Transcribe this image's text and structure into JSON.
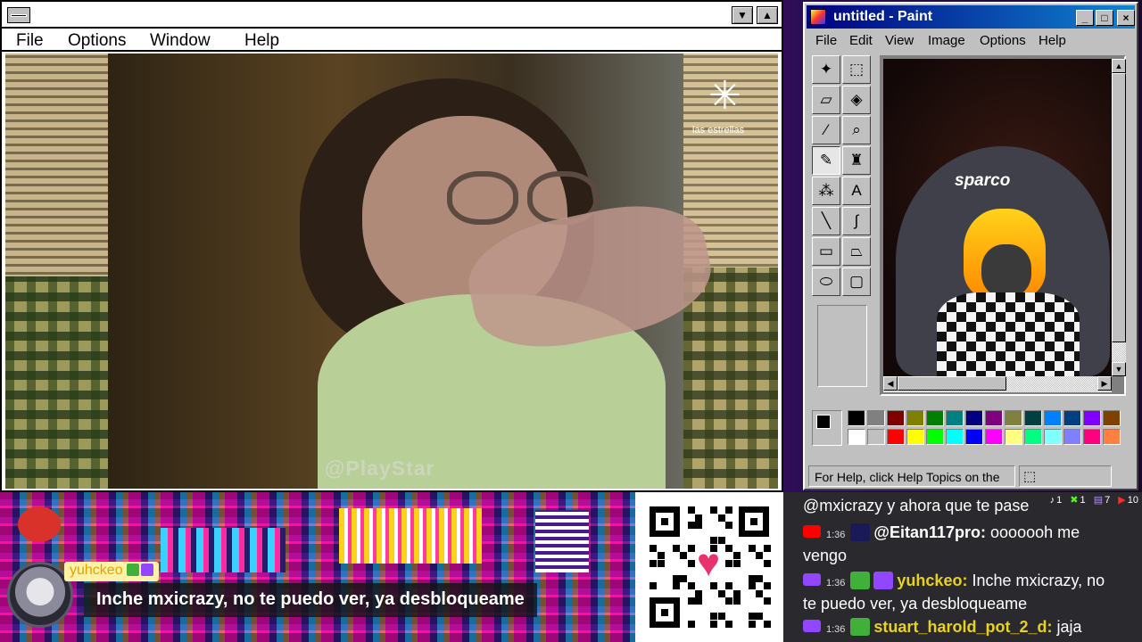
{
  "media_window": {
    "menu": [
      "File",
      "Options",
      "Window",
      "Help"
    ],
    "title_buttons": {
      "minimize": "▼",
      "maximize": "▲"
    },
    "video": {
      "watermark": "@PlayStar",
      "logo_text": "las estrellas"
    }
  },
  "paint": {
    "title": "untitled - Paint",
    "menu": [
      "File",
      "Edit",
      "View",
      "Image",
      "Options",
      "Help"
    ],
    "tools": [
      {
        "name": "free-select-icon",
        "glyph": "✦"
      },
      {
        "name": "rect-select-icon",
        "glyph": "⬚"
      },
      {
        "name": "eraser-icon",
        "glyph": "▱"
      },
      {
        "name": "fill-bucket-icon",
        "glyph": "◈"
      },
      {
        "name": "color-picker-icon",
        "glyph": "⁄"
      },
      {
        "name": "magnifier-icon",
        "glyph": "⌕"
      },
      {
        "name": "pencil-icon",
        "glyph": "✎"
      },
      {
        "name": "brush-icon",
        "glyph": "♜"
      },
      {
        "name": "airbrush-icon",
        "glyph": "⁂"
      },
      {
        "name": "text-icon",
        "glyph": "A"
      },
      {
        "name": "line-icon",
        "glyph": "╲"
      },
      {
        "name": "curve-icon",
        "glyph": "∫"
      },
      {
        "name": "rectangle-icon",
        "glyph": "▭"
      },
      {
        "name": "polygon-icon",
        "glyph": "⏢"
      },
      {
        "name": "ellipse-icon",
        "glyph": "⬭"
      },
      {
        "name": "rounded-rect-icon",
        "glyph": "▢"
      }
    ],
    "canvas_chair_logo": "sparco",
    "palette_top": [
      "#000000",
      "#808080",
      "#800000",
      "#808000",
      "#008000",
      "#008080",
      "#000080",
      "#800080",
      "#808040",
      "#004040",
      "#0080ff",
      "#004080",
      "#8000ff",
      "#804000"
    ],
    "palette_bottom": [
      "#ffffff",
      "#c0c0c0",
      "#ff0000",
      "#ffff00",
      "#00ff00",
      "#00ffff",
      "#0000ff",
      "#ff00ff",
      "#ffff80",
      "#00ff80",
      "#80ffff",
      "#8080ff",
      "#ff0080",
      "#ff8040"
    ],
    "status": "For Help, click Help Topics on the"
  },
  "overlay": {
    "username": "yuhckeo",
    "message": "Inche mxicrazy, no te puedo ver, ya desbloqueame"
  },
  "chat": {
    "stats": [
      {
        "icon": "tiktok-icon",
        "value": "1"
      },
      {
        "icon": "kick-icon",
        "value": "1"
      },
      {
        "icon": "twitch-icon",
        "value": "7"
      },
      {
        "icon": "youtube-icon",
        "value": "10"
      }
    ],
    "lines": [
      {
        "text": "@mxicrazy y ahora que te pase"
      },
      {
        "platform": "youtube",
        "time": "1:36",
        "user": "@Eitan117pro:",
        "user_color": "#ffffff",
        "msg": "ooooooh me"
      },
      {
        "text": "vengo"
      },
      {
        "platform": "twitch",
        "time": "1:36",
        "user": "yuhckeo:",
        "user_color": "#e8d21a",
        "msg": "Inche mxicrazy, no"
      },
      {
        "text": "te puedo ver, ya desbloqueame"
      },
      {
        "platform": "twitch",
        "time": "1:36",
        "user": "stuart_harold_pot_2_d:",
        "user_color": "#e8d21a",
        "msg": "jaja"
      }
    ]
  },
  "colors": {
    "youtube": "#ff0000",
    "twitch": "#9146ff",
    "paint_title_start": "#000080",
    "paint_title_end": "#1084d0"
  }
}
